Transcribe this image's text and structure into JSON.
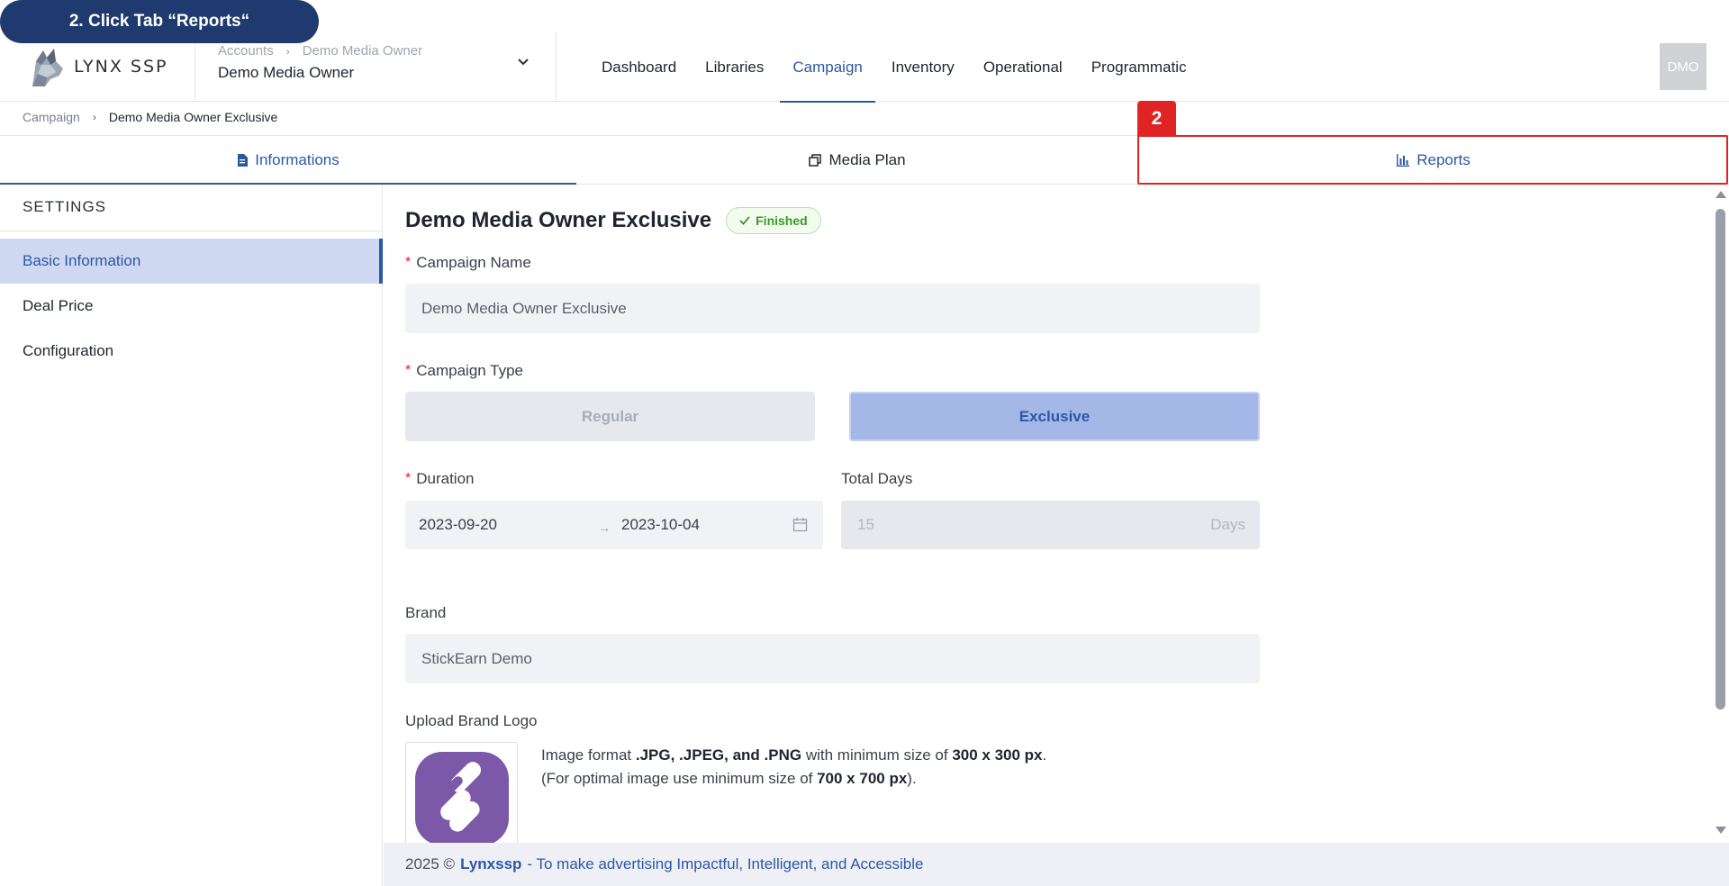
{
  "step_banner": "2. Click Tab “Reports“",
  "step_badge": "2",
  "header": {
    "logo_text": "LYNX SSP",
    "account_crumbs": [
      "Accounts",
      "Demo Media Owner"
    ],
    "account_name": "Demo Media Owner",
    "nav": [
      "Dashboard",
      "Libraries",
      "Campaign",
      "Inventory",
      "Operational",
      "Programmatic"
    ],
    "active_nav": "Campaign",
    "avatar": "DMO"
  },
  "breadcrumb": [
    "Campaign",
    "Demo Media Owner Exclusive"
  ],
  "tabs": [
    {
      "label": "Informations",
      "icon": "document-icon"
    },
    {
      "label": "Media Plan",
      "icon": "copy-icon"
    },
    {
      "label": "Reports",
      "icon": "bar-chart-icon"
    }
  ],
  "sidebar": {
    "title": "SETTINGS",
    "items": [
      "Basic Information",
      "Deal Price",
      "Configuration"
    ]
  },
  "main": {
    "title": "Demo Media Owner Exclusive",
    "status": "Finished",
    "campaign_name_label": "Campaign Name",
    "campaign_name_value": "Demo Media Owner Exclusive",
    "campaign_type_label": "Campaign Type",
    "type_options": [
      "Regular",
      "Exclusive"
    ],
    "selected_type": "Exclusive",
    "duration_label": "Duration",
    "date_start": "2023-09-20",
    "date_end": "2023-10-04",
    "total_days_label": "Total Days",
    "total_days_value": "15",
    "total_days_unit": "Days",
    "brand_label": "Brand",
    "brand_value": "StickEarn Demo",
    "upload_label": "Upload Brand Logo",
    "upload_line1_a": "Image format ",
    "upload_line1_b": ".JPG, .JPEG, and .PNG",
    "upload_line1_c": " with minimum size of ",
    "upload_line1_d": "300 x 300 px",
    "upload_line1_e": ".",
    "upload_line2_a": "(For optimal image use minimum size of ",
    "upload_line2_b": "700 x 700 px",
    "upload_line2_c": ")."
  },
  "footer": {
    "prefix": "2025 ©",
    "brand": "Lynxssp",
    "tagline": "- To make advertising Impactful, Intelligent, and Accessible"
  },
  "colors": {
    "accent": "#2c57a6",
    "highlight": "#e02424",
    "banner": "#1e3a6e",
    "success": "#3a9a2a"
  }
}
